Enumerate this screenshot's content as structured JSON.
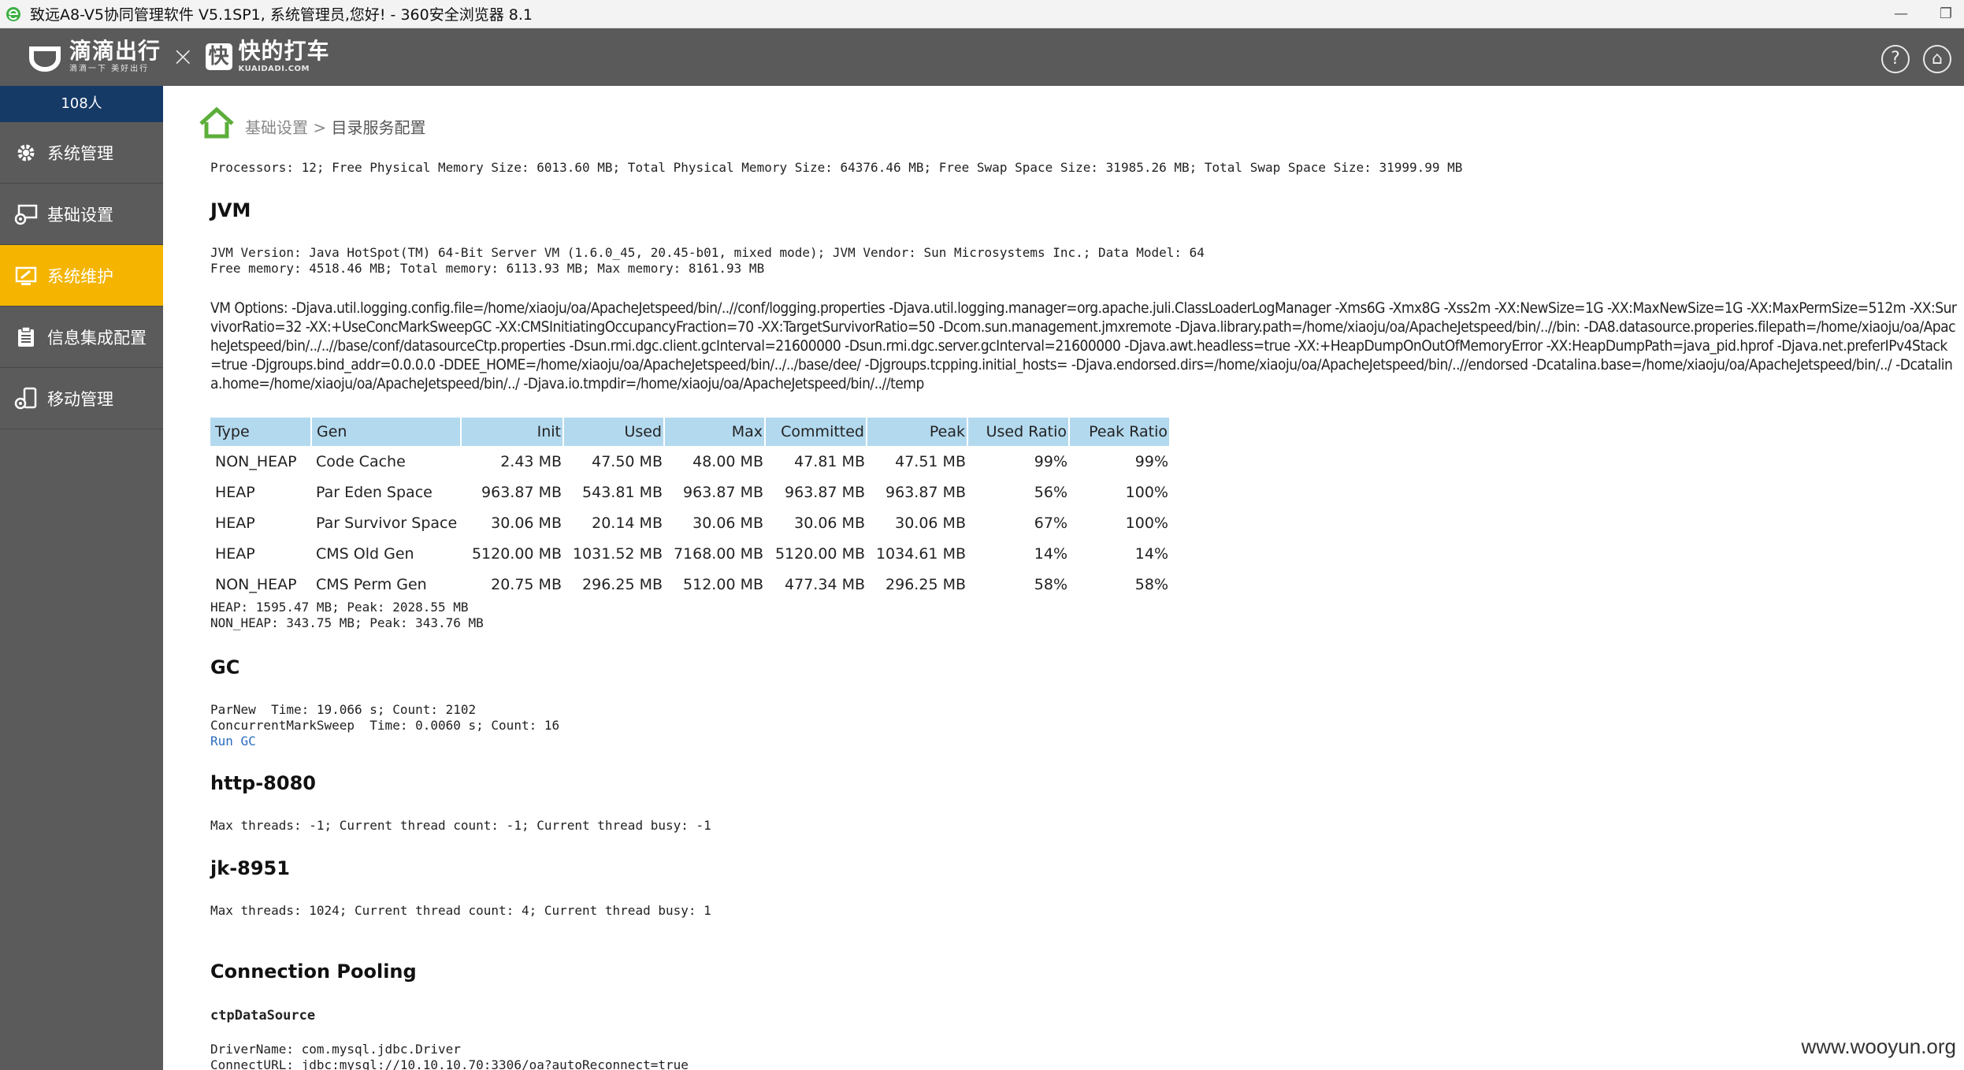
{
  "browser": {
    "title": "致远A8-V5协同管理软件 V5.1SP1, 系统管理员,您好! - 360安全浏览器 8.1",
    "minimize": "—",
    "restore": "❐"
  },
  "header": {
    "brand1": {
      "name": "滴滴出行",
      "slogan": "滴滴一下 美好出行"
    },
    "times": "×",
    "brand2": {
      "mark": "快",
      "name": "快的打车",
      "domain": "KUAIDADI.COM"
    },
    "icons": [
      "help-icon",
      "home-icon"
    ],
    "help_glyph": "?",
    "home_glyph": "⌂"
  },
  "sidebar": {
    "online_count": "108人",
    "items": [
      {
        "label": "系统管理",
        "icon": "gear-icon",
        "active": false
      },
      {
        "label": "基础设置",
        "icon": "settings-monitor-icon",
        "active": false
      },
      {
        "label": "系统维护",
        "icon": "maintenance-monitor-icon",
        "active": true
      },
      {
        "label": "信息集成配置",
        "icon": "clipboard-icon",
        "active": false
      },
      {
        "label": "移动管理",
        "icon": "mobile-icon",
        "active": false
      }
    ],
    "active_color": "#f4b400"
  },
  "breadcrumb": {
    "parent": "基础设置",
    "separator": " > ",
    "current": "目录服务配置"
  },
  "system": {
    "processors_line": "Processors: 12; Free Physical Memory Size: 6013.60 MB; Total Physical Memory Size: 64376.46 MB; Free Swap Space Size: 31985.26 MB; Total Swap Space Size: 31999.99 MB"
  },
  "jvm": {
    "heading": "JVM",
    "version_line": "JVM Version: Java HotSpot(TM) 64-Bit Server VM (1.6.0_45, 20.45-b01, mixed mode); JVM Vendor: Sun Microsystems Inc.; Data Model: 64",
    "memory_line": "Free memory: 4518.46 MB; Total memory: 6113.93 MB; Max memory: 8161.93 MB",
    "vm_options": "VM Options: -Djava.util.logging.config.file=/home/xiaoju/oa/ApacheJetspeed/bin/..//conf/logging.properties -Djava.util.logging.manager=org.apache.juli.ClassLoaderLogManager -Xms6G -Xmx8G -Xss2m -XX:NewSize=1G -XX:MaxNewSize=1G -XX:MaxPermSize=512m -XX:SurvivorRatio=32 -XX:+UseConcMarkSweepGC -XX:CMSInitiatingOccupancyFraction=70 -XX:TargetSurvivorRatio=50 -Dcom.sun.management.jmxremote -Djava.library.path=/home/xiaoju/oa/ApacheJetspeed/bin/..//bin: -DA8.datasource.properies.filepath=/home/xiaoju/oa/ApacheJetspeed/bin/../..//base/conf/datasourceCtp.properties -Dsun.rmi.dgc.client.gcInterval=21600000 -Dsun.rmi.dgc.server.gcInterval=21600000 -Djava.awt.headless=true -XX:+HeapDumpOnOutOfMemoryError -XX:HeapDumpPath=java_pid.hprof -Djava.net.preferIPv4Stack=true -Djgroups.bind_addr=0.0.0.0 -DDEE_HOME=/home/xiaoju/oa/ApacheJetspeed/bin/../../base/dee/ -Djgroups.tcpping.initial_hosts= -Djava.endorsed.dirs=/home/xiaoju/oa/ApacheJetspeed/bin/..//endorsed -Dcatalina.base=/home/xiaoju/oa/ApacheJetspeed/bin/../ -Dcatalina.home=/home/xiaoju/oa/ApacheJetspeed/bin/../ -Djava.io.tmpdir=/home/xiaoju/oa/ApacheJetspeed/bin/..//temp"
  },
  "memory_table": {
    "columns": [
      "Type",
      "Gen",
      "Init",
      "Used",
      "Max",
      "Committed",
      "Peak",
      "Used Ratio",
      "Peak Ratio"
    ],
    "rows": [
      [
        "NON_HEAP",
        "Code Cache",
        "2.43 MB",
        "47.50 MB",
        "48.00 MB",
        "47.81 MB",
        "47.51 MB",
        "99%",
        "99%"
      ],
      [
        "HEAP",
        "Par Eden Space",
        "963.87 MB",
        "543.81 MB",
        "963.87 MB",
        "963.87 MB",
        "963.87 MB",
        "56%",
        "100%"
      ],
      [
        "HEAP",
        "Par Survivor Space",
        "30.06 MB",
        "20.14 MB",
        "30.06 MB",
        "30.06 MB",
        "30.06 MB",
        "67%",
        "100%"
      ],
      [
        "HEAP",
        "CMS Old Gen",
        "5120.00 MB",
        "1031.52 MB",
        "7168.00 MB",
        "5120.00 MB",
        "1034.61 MB",
        "14%",
        "14%"
      ],
      [
        "NON_HEAP",
        "CMS Perm Gen",
        "20.75 MB",
        "296.25 MB",
        "512.00 MB",
        "477.34 MB",
        "296.25 MB",
        "58%",
        "58%"
      ]
    ],
    "header_color": "#b3d9ee"
  },
  "memory_summary": {
    "heap": "HEAP: 1595.47 MB; Peak: 2028.55 MB",
    "non_heap": "NON_HEAP: 343.75 MB; Peak: 343.76 MB"
  },
  "gc": {
    "heading": "GC",
    "lines": [
      "ParNew  Time: 19.066 s; Count: 2102",
      "ConcurrentMarkSweep  Time: 0.0060 s; Count: 16"
    ],
    "run_link": "Run GC"
  },
  "http": {
    "heading": "http-8080",
    "line": "Max threads: -1; Current thread count: -1; Current thread busy: -1"
  },
  "jk": {
    "heading": "jk-8951",
    "line": "Max threads: 1024; Current thread count: 4; Current thread busy: 1"
  },
  "pooling": {
    "heading": "Connection Pooling",
    "datasource": "ctpDataSource",
    "driver_line": "DriverName: com.mysql.jdbc.Driver",
    "url_line": "ConnectURL: jdbc:mysql://10.10.10.70:3306/oa?autoReconnect=true"
  },
  "watermark": "www.wooyun.org"
}
